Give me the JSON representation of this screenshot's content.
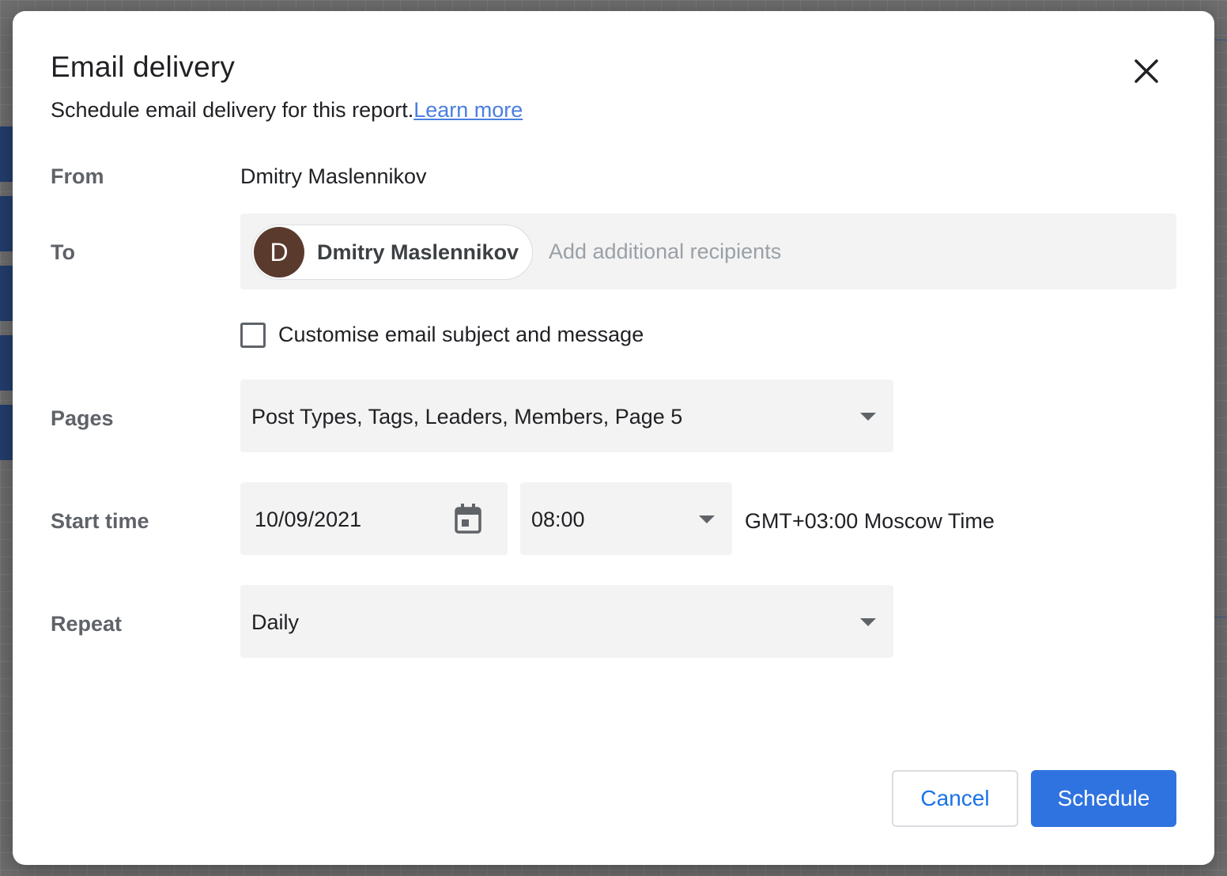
{
  "dialog": {
    "title": "Email delivery",
    "subtitle": "Schedule email delivery for this report.",
    "learn_more": "Learn more"
  },
  "from": {
    "label": "From",
    "value": "Dmitry Maslennikov"
  },
  "to": {
    "label": "To",
    "chip": {
      "initial": "D",
      "name": "Dmitry Maslennikov"
    },
    "placeholder": "Add additional recipients",
    "value": ""
  },
  "customise": {
    "label": "Customise email subject and message",
    "checked": false
  },
  "pages": {
    "label": "Pages",
    "selected": "Post Types, Tags, Leaders, Members, Page 5"
  },
  "start_time": {
    "label": "Start time",
    "date": "10/09/2021",
    "time": "08:00",
    "timezone": "GMT+03:00 Moscow Time"
  },
  "repeat": {
    "label": "Repeat",
    "selected": "Daily"
  },
  "buttons": {
    "cancel": "Cancel",
    "schedule": "Schedule"
  },
  "icons": {
    "close": "close-icon",
    "calendar": "calendar-icon",
    "dropdown": "chevron-down-icon"
  },
  "colors": {
    "primary": "#2f73e0",
    "link": "#4a7ee0",
    "avatar": "#5b3a2e",
    "field_bg": "#f3f3f3"
  }
}
